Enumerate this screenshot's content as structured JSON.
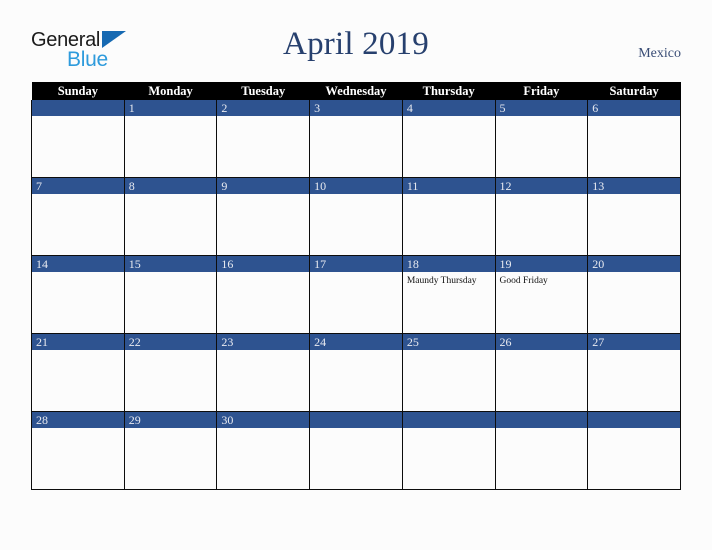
{
  "logo": {
    "word_one": "General",
    "word_two": "Blue",
    "triangle_icon": "blue-triangle-icon",
    "accent_dark": "#1b1b1b",
    "accent_blue": "#2e9bdc",
    "triangle_color": "#1669b2"
  },
  "header": {
    "title": "April 2019",
    "country": "Mexico",
    "title_color": "#27406e"
  },
  "theme": {
    "header_row_bg": "#000000",
    "date_band_bg": "#2e5390",
    "cell_bg": "#fcfcfc",
    "border": "#0d0d0d",
    "page_bg": "#fcfcfc"
  },
  "calendar": {
    "weekday_headers": [
      "Sunday",
      "Monday",
      "Tuesday",
      "Wednesday",
      "Thursday",
      "Friday",
      "Saturday"
    ],
    "weeks": [
      [
        {
          "date": "",
          "event": ""
        },
        {
          "date": "1",
          "event": ""
        },
        {
          "date": "2",
          "event": ""
        },
        {
          "date": "3",
          "event": ""
        },
        {
          "date": "4",
          "event": ""
        },
        {
          "date": "5",
          "event": ""
        },
        {
          "date": "6",
          "event": ""
        }
      ],
      [
        {
          "date": "7",
          "event": ""
        },
        {
          "date": "8",
          "event": ""
        },
        {
          "date": "9",
          "event": ""
        },
        {
          "date": "10",
          "event": ""
        },
        {
          "date": "11",
          "event": ""
        },
        {
          "date": "12",
          "event": ""
        },
        {
          "date": "13",
          "event": ""
        }
      ],
      [
        {
          "date": "14",
          "event": ""
        },
        {
          "date": "15",
          "event": ""
        },
        {
          "date": "16",
          "event": ""
        },
        {
          "date": "17",
          "event": ""
        },
        {
          "date": "18",
          "event": "Maundy Thursday"
        },
        {
          "date": "19",
          "event": "Good Friday"
        },
        {
          "date": "20",
          "event": ""
        }
      ],
      [
        {
          "date": "21",
          "event": ""
        },
        {
          "date": "22",
          "event": ""
        },
        {
          "date": "23",
          "event": ""
        },
        {
          "date": "24",
          "event": ""
        },
        {
          "date": "25",
          "event": ""
        },
        {
          "date": "26",
          "event": ""
        },
        {
          "date": "27",
          "event": ""
        }
      ],
      [
        {
          "date": "28",
          "event": ""
        },
        {
          "date": "29",
          "event": ""
        },
        {
          "date": "30",
          "event": ""
        },
        {
          "date": "",
          "event": ""
        },
        {
          "date": "",
          "event": ""
        },
        {
          "date": "",
          "event": ""
        },
        {
          "date": "",
          "event": ""
        }
      ]
    ]
  }
}
